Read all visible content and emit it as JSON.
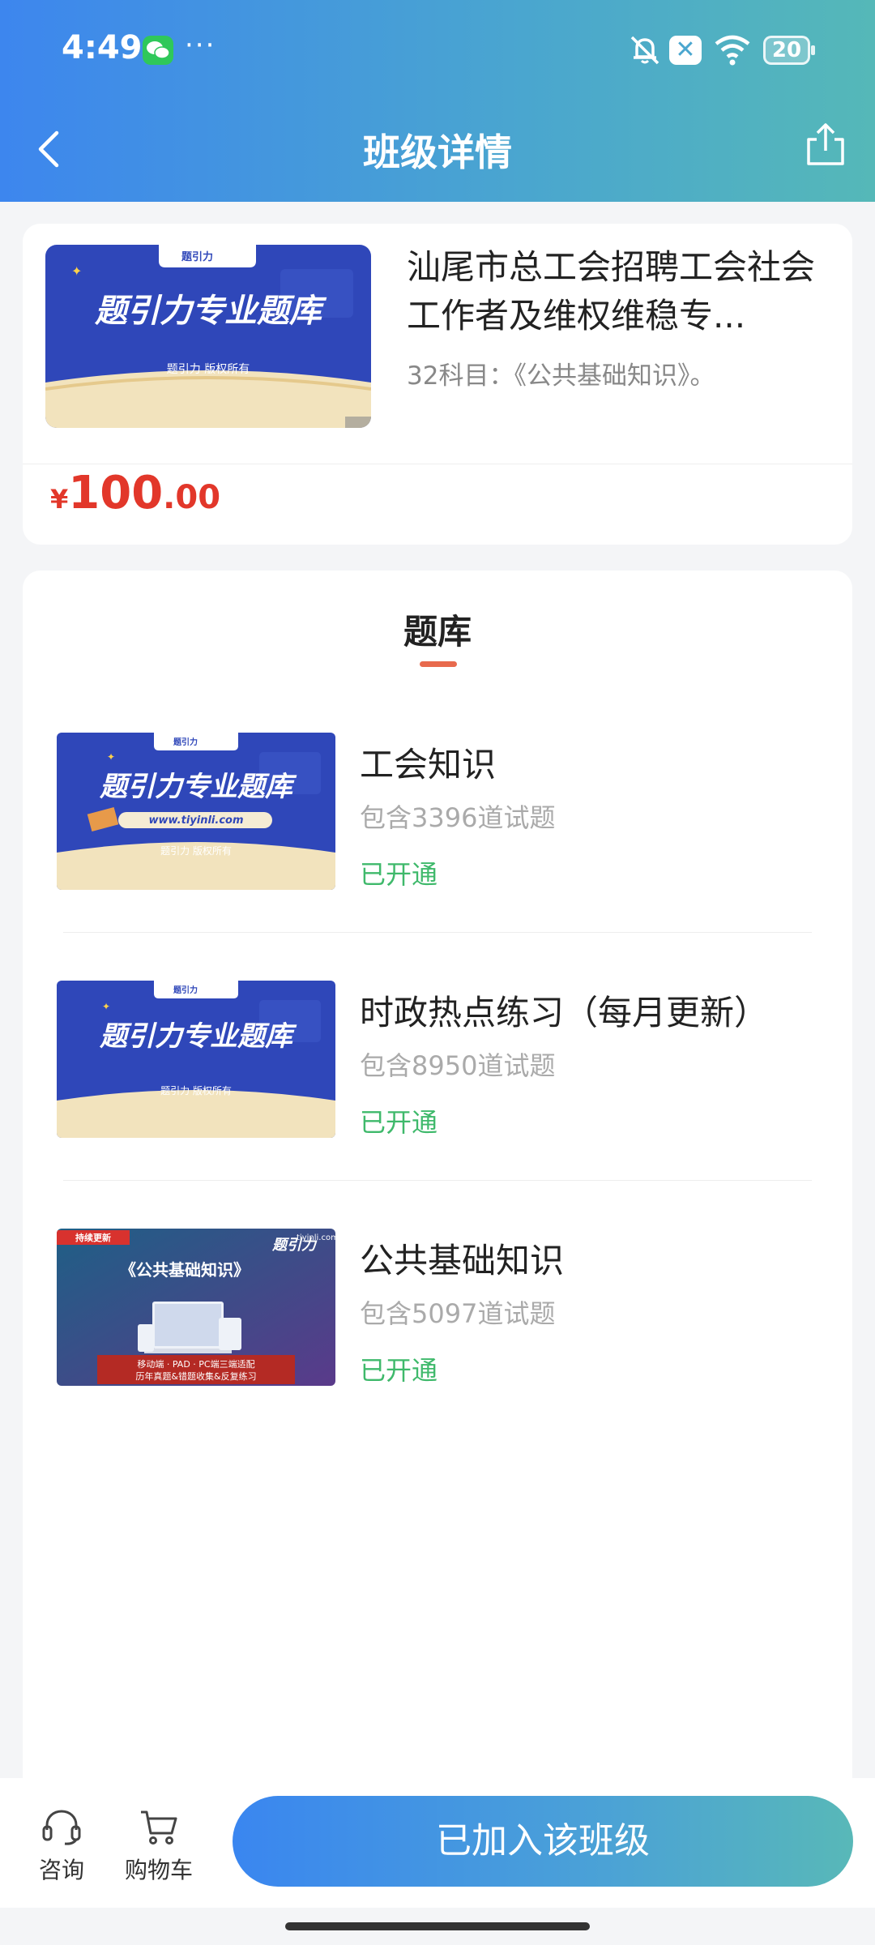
{
  "status_bar": {
    "time": "4:49",
    "dots": "···",
    "close_badge": "✕",
    "battery": "20"
  },
  "nav": {
    "title": "班级详情",
    "back_icon": "chevron-left-icon",
    "share_icon": "share-icon"
  },
  "course": {
    "title": "汕尾市总工会招聘工会社会工作者及维权维稳专...",
    "subtitle": "32科目：《公共基础知识》。",
    "thumb_brand": "题引力",
    "thumb_banner": "题引力专业题库",
    "thumb_footer": "题引力 版权所有",
    "price_currency": "¥",
    "price_integer": "100",
    "price_decimal": ".00"
  },
  "bank_section": {
    "heading": "题库",
    "items": [
      {
        "name": "工会知识",
        "count": "包含3396道试题",
        "status": "已开通",
        "thumb_brand": "题引力",
        "thumb_banner": "题引力专业题库",
        "thumb_url": "www.tiyinli.com",
        "thumb_footer": "题引力 版权所有"
      },
      {
        "name": "时政热点练习（每月更新）",
        "count": "包含8950道试题",
        "status": "已开通",
        "thumb_brand": "题引力",
        "thumb_banner": "题引力专业题库",
        "thumb_footer": "题引力 版权所有"
      },
      {
        "name": "公共基础知识",
        "count": "包含5097道试题",
        "status": "已开通",
        "thumb_tag": "持续更新",
        "thumb_site": "tiyinli.com",
        "thumb_logo": "题引力",
        "thumb_title": "《公共基础知识》",
        "thumb_line1": "移动端 · PAD · PC端三端适配",
        "thumb_line2": "历年真题&错题收集&反复练习"
      }
    ]
  },
  "bottom_bar": {
    "consult_label": "咨询",
    "cart_label": "购物车",
    "join_label": "已加入该班级"
  },
  "colors": {
    "header_start": "#3d86ee",
    "header_end": "#55b8b8",
    "price_red": "#e2372a",
    "status_green": "#3fb96b",
    "tab_indicator": "#e86a4d"
  }
}
